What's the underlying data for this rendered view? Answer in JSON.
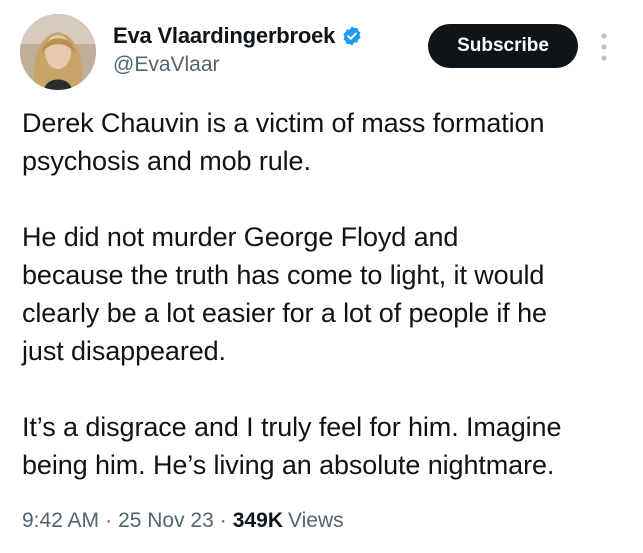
{
  "author": {
    "display_name": "Eva Vlaardingerbroek",
    "handle": "@EvaVlaar",
    "verified": true,
    "verified_color": "#1d9bf0"
  },
  "actions": {
    "subscribe_label": "Subscribe",
    "more_icon": "more-vertical-icon"
  },
  "tweet": {
    "paragraphs": [
      "Derek Chauvin is a victim of mass formation\npsychosis and mob rule.",
      "He did not murder George Floyd and\nbecause the truth has come to light, it would\nclearly be a lot easier for a lot of people if he\njust disappeared.",
      "It’s a disgrace and I truly feel for him. Imagine\nbeing him. He’s living an absolute nightmare."
    ]
  },
  "meta": {
    "time": "9:42 AM",
    "separator": "·",
    "date": "25 Nov 23",
    "views_count": "349K",
    "views_label": "Views"
  }
}
